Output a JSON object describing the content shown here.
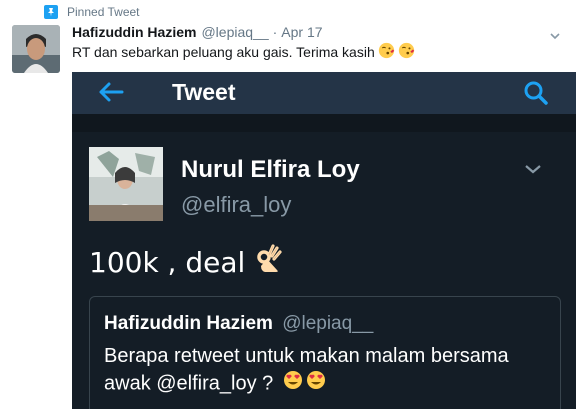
{
  "pinned": {
    "label": "Pinned Tweet",
    "icon": "pin-icon"
  },
  "tweet": {
    "author_name": "Hafizuddin Haziem",
    "author_handle": "@lepiaq__",
    "separator": "·",
    "timestamp": "Apr 17",
    "text": "RT dan sebarkan peluang aku gais. Terima kasih",
    "emojis": [
      "kissing-face-emoji",
      "kissing-face-emoji"
    ]
  },
  "screenshot": {
    "header_title": "Tweet",
    "author_name": "Nurul Elfira Loy",
    "author_handle": "@elfira_loy",
    "text": "100k , deal",
    "text_emoji": "ok-hand-emoji",
    "quote": {
      "author_name": "Hafizuddin Haziem",
      "author_handle": "@lepiaq__",
      "text": "Berapa retweet untuk makan malam bersama awak @elfira_loy ?",
      "emojis": [
        "heart-eyes-emoji",
        "heart-eyes-emoji"
      ]
    }
  },
  "colors": {
    "accent": "#1da1f2",
    "screenshot_bg": "#141d26",
    "screenshot_header": "#243447",
    "muted": "#657786"
  }
}
